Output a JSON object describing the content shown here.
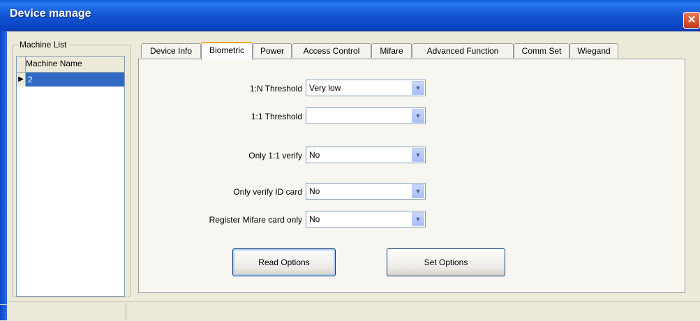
{
  "window": {
    "title": "Device manage",
    "close_label": "✕"
  },
  "machine_list": {
    "legend": "Machine List",
    "column_header": "Machine Name",
    "rows": [
      {
        "indicator": "▶",
        "name": "2"
      }
    ]
  },
  "tabs": [
    {
      "label": "Device Info"
    },
    {
      "label": "Biometric"
    },
    {
      "label": "Power"
    },
    {
      "label": "Access Control"
    },
    {
      "label": "Mifare"
    },
    {
      "label": "Advanced Function"
    },
    {
      "label": "Comm Set"
    },
    {
      "label": "Wiegand"
    }
  ],
  "active_tab": "Biometric",
  "fields": [
    {
      "label": "1:N Threshold",
      "value": "Very low"
    },
    {
      "label": "1:1 Threshold",
      "value": ""
    },
    {
      "label": "Only 1:1 verify",
      "value": "No"
    },
    {
      "label": "Only verify ID card",
      "value": "No"
    },
    {
      "label": "Register Mifare card only",
      "value": "No"
    }
  ],
  "buttons": {
    "read": "Read Options",
    "set": "Set Options"
  },
  "icons": {
    "dropdown": "▼"
  }
}
